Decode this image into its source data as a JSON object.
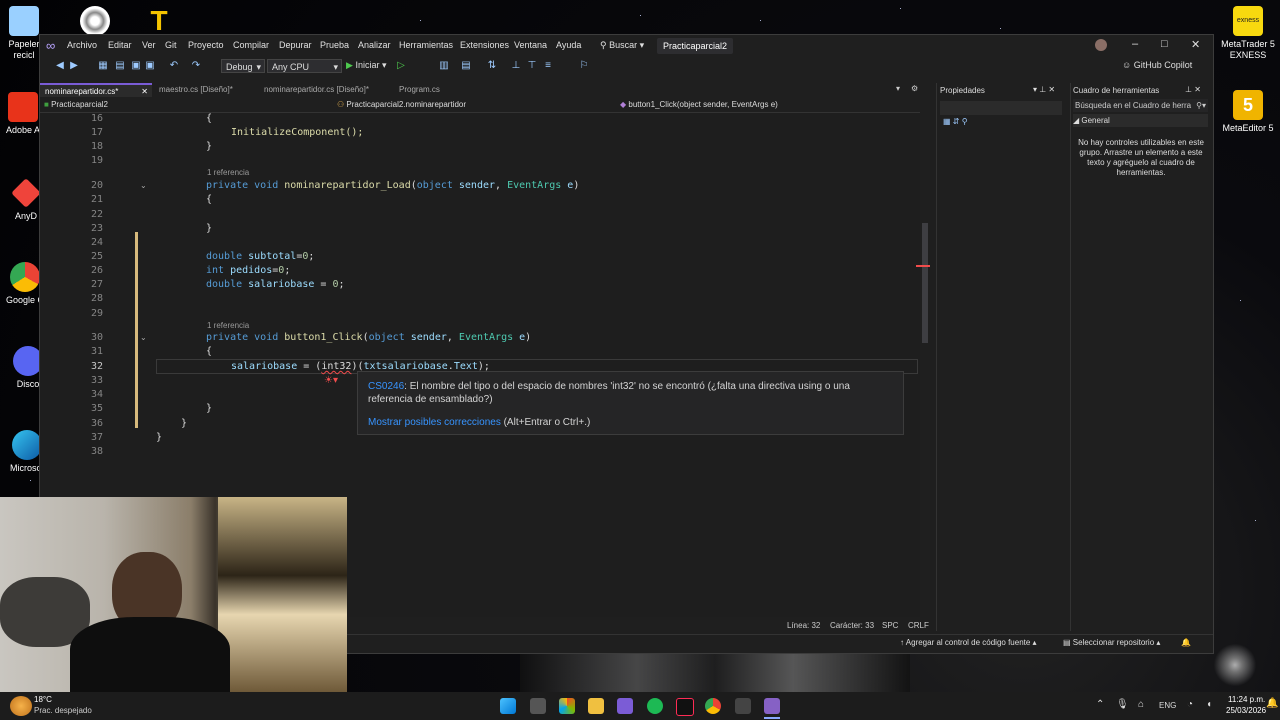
{
  "desktop": {
    "left_icons": [
      {
        "label": "Papeler\nrecicl",
        "icon": "recycle-bin-icon"
      },
      {
        "label": "Adobe A",
        "icon": "adobe-icon"
      },
      {
        "label": "AnyD",
        "icon": "anydesk-icon"
      },
      {
        "label": "Google C",
        "icon": "chrome-icon"
      },
      {
        "label": "Disco",
        "icon": "discord-icon"
      },
      {
        "label": "Microsof",
        "icon": "edge-icon"
      }
    ],
    "right_icons": [
      {
        "label": "MetaTrader 5\nEXNESS",
        "icon": "exness-icon",
        "badge": "exness"
      },
      {
        "label": "MetaEditor 5",
        "icon": "metaeditor-icon"
      }
    ]
  },
  "vs": {
    "menu": [
      "Archivo",
      "Editar",
      "Ver",
      "Git",
      "Proyecto",
      "Compilar",
      "Depurar",
      "Prueba",
      "Analizar",
      "Herramientas",
      "Extensiones",
      "Ventana",
      "Ayuda"
    ],
    "search_label": "Buscar",
    "solution_name": "Practicaparcial2",
    "config": "Debug",
    "platform": "Any CPU",
    "run_label": "Iniciar",
    "copilot": "GitHub Copilot",
    "tabs": [
      {
        "label": "nominarepartidor.cs*",
        "active": true
      },
      {
        "label": "maestro.cs [Diseño]*",
        "active": false
      },
      {
        "label": "nominarepartidor.cs [Diseño]*",
        "active": false
      },
      {
        "label": "Program.cs",
        "active": false
      }
    ],
    "nav": {
      "project": "Practicaparcial2",
      "class": "Practicaparcial2.nominarepartidor",
      "member": "button1_Click(object sender, EventArgs e)"
    },
    "code": {
      "line_numbers": [
        "16",
        "17",
        "18",
        "19",
        "20",
        "21",
        "22",
        "23",
        "24",
        "25",
        "26",
        "27",
        "28",
        "29",
        "30",
        "31",
        "32",
        "33",
        "34",
        "35",
        "36",
        "37",
        "38"
      ],
      "ref_hint": "1 referencia",
      "l16": "{",
      "l17": "InitializeComponent();",
      "l18": "}",
      "l20_kw": "private void ",
      "l20_fn": "nominarepartidor_Load",
      "l20_rest1": "(",
      "l20_t1": "object",
      "l20_p1": " sender",
      "l20_comma": ", ",
      "l20_t2": "EventArgs",
      "l20_p2": " e",
      "l20_close": ")",
      "l21": "{",
      "l23": "}",
      "l25_kw": "double ",
      "l25_var": "subtotal",
      "l25_rest": "=",
      "l25_num": "0",
      "l25_end": ";",
      "l26_kw": "int ",
      "l26_var": "pedidos",
      "l26_rest": "=",
      "l26_num": "0",
      "l26_end": ";",
      "l27_kw": "double ",
      "l27_var": "salariobase",
      "l27_rest": " = ",
      "l27_num": "0",
      "l27_end": ";",
      "l30_kw": "private void ",
      "l30_fn": "button1_Click",
      "l30_t2": "EventArgs",
      "l31": "{",
      "l32_var": "salariobase",
      "l32_eq": " = (",
      "l32_err": "int32",
      "l32_rest": ")(",
      "l32_obj": "txtsalariobase",
      "l32_dot": ".",
      "l32_prop": "Text",
      "l32_end": ");",
      "l35": "}",
      "l36": "}",
      "l37": "}"
    },
    "error_popup": {
      "code": "CS0246",
      "message": ": El nombre del tipo o del espacio de nombres 'int32' no se encontró (¿falta una directiva using o una referencia de ensamblado?)",
      "action_link": "Mostrar posibles correcciones",
      "action_keys": " (Alt+Entrar o Ctrl+.)"
    },
    "editor_status": {
      "line": "Línea: 32",
      "col": "Carácter: 33",
      "ws": "SPC",
      "eol": "CRLF"
    },
    "properties": {
      "title": "Propiedades"
    },
    "toolbox": {
      "title": "Cuadro de herramientas",
      "search_placeholder": "Búsqueda en el Cuadro de herra",
      "group": "General",
      "empty_message": "No hay controles utilizables en este grupo. Arrastre un elemento a este texto y agréguelo al cuadro de herramientas."
    },
    "statusbar": {
      "source_control": "Agregar al control de código fuente",
      "repo": "Seleccionar repositorio"
    }
  },
  "taskbar": {
    "weather_temp": "18°C",
    "weather_desc": "Prac. despejado",
    "lang": "ENG",
    "time": "11:24 p.m.",
    "date": "25/03/2026"
  },
  "colors": {
    "accent": "#7a5cd6",
    "link": "#3794ff",
    "error": "#f14c4c"
  }
}
